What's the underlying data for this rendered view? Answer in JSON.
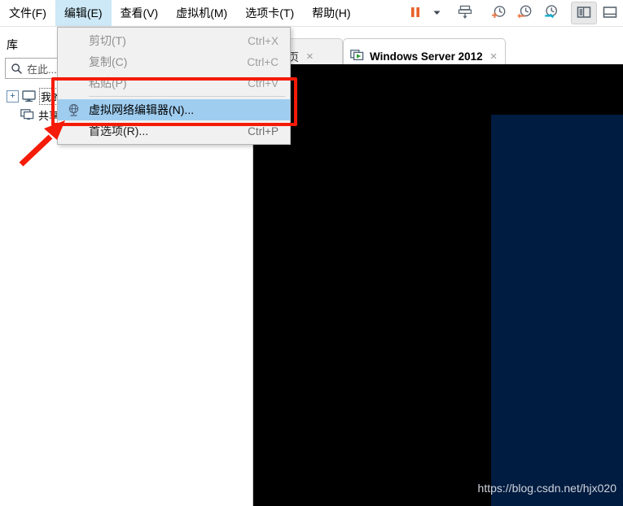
{
  "menubar": {
    "items": [
      {
        "label": "文件(F)",
        "accel_char": "F",
        "name": "menu-file",
        "active": false
      },
      {
        "label": "编辑(E)",
        "accel_char": "E",
        "name": "menu-edit",
        "active": true
      },
      {
        "label": "查看(V)",
        "accel_char": "V",
        "name": "menu-view",
        "active": false
      },
      {
        "label": "虚拟机(M)",
        "accel_char": "M",
        "name": "menu-vm",
        "active": false
      },
      {
        "label": "选项卡(T)",
        "accel_char": "T",
        "name": "menu-tabs",
        "active": false
      },
      {
        "label": "帮助(H)",
        "accel_char": "H",
        "name": "menu-help",
        "active": false
      }
    ]
  },
  "toolbar": {
    "buttons": [
      {
        "icon": "pause-icon",
        "name": "suspend-button"
      },
      {
        "icon": "chevron-down-icon",
        "name": "power-dropdown-button"
      },
      {
        "icon": "send-ctrl-alt-del-icon",
        "name": "send-ctrl-alt-del-button"
      },
      {
        "icon": "snapshot-take-icon",
        "name": "take-snapshot-button"
      },
      {
        "icon": "snapshot-revert-icon",
        "name": "revert-snapshot-button"
      },
      {
        "icon": "snapshot-manager-icon",
        "name": "snapshot-manager-button"
      },
      {
        "icon": "show-library-icon",
        "name": "show-library-button",
        "pressed": true
      },
      {
        "icon": "show-thumbnail-bar-icon",
        "name": "show-thumbnail-bar-button",
        "pressed": false
      }
    ],
    "colors": {
      "pause_orange": "#E8622A",
      "snapshot_orange": "#E8804F",
      "snapshot_teal": "#17AECD",
      "icon_gray": "#5A6672"
    }
  },
  "sidebar": {
    "title": "库",
    "search": {
      "placeholder": "在此...",
      "value": "",
      "icon": "search-icon"
    },
    "tree": [
      {
        "label": "我的计算机",
        "icon": "my-computer-icon",
        "expander": "+",
        "has_expander": true,
        "focused": true
      },
      {
        "label": "共享虚拟机",
        "icon": "shared-vms-icon",
        "expander": "",
        "has_expander": false,
        "focused": false
      }
    ]
  },
  "tabs": [
    {
      "label": "主页",
      "icon": "home-tab-icon",
      "active": false,
      "close": "×",
      "name": "tab-home"
    },
    {
      "label": "Windows Server 2012",
      "icon": "vm-running-icon",
      "active": true,
      "close": "×",
      "name": "tab-windows-server-2012"
    }
  ],
  "dropdown": {
    "owner": "编辑(E)",
    "items": [
      {
        "label": "剪切(T)",
        "accel": "Ctrl+X",
        "disabled": true,
        "highlight": false,
        "icon": "",
        "name": "menu-item-cut"
      },
      {
        "label": "复制(C)",
        "accel": "Ctrl+C",
        "disabled": true,
        "highlight": false,
        "icon": "",
        "name": "menu-item-copy"
      },
      {
        "label": "粘贴(P)",
        "accel": "Ctrl+V",
        "disabled": true,
        "highlight": false,
        "icon": "",
        "name": "menu-item-paste"
      },
      {
        "label": "虚拟网络编辑器(N)...",
        "accel": "",
        "disabled": false,
        "highlight": true,
        "icon": "globe-icon",
        "name": "menu-item-virtual-network-editor"
      },
      {
        "label": "首选项(R)...",
        "accel": "Ctrl+P",
        "disabled": false,
        "highlight": false,
        "icon": "",
        "name": "menu-item-preferences"
      }
    ]
  },
  "console": {
    "watermark": "https://blog.csdn.net/hjx020",
    "background": "#000000",
    "panel_color": "#011c41"
  },
  "annotations": {
    "highlight_rect_color": "#f41b08",
    "arrow_color": "#f41b08"
  }
}
